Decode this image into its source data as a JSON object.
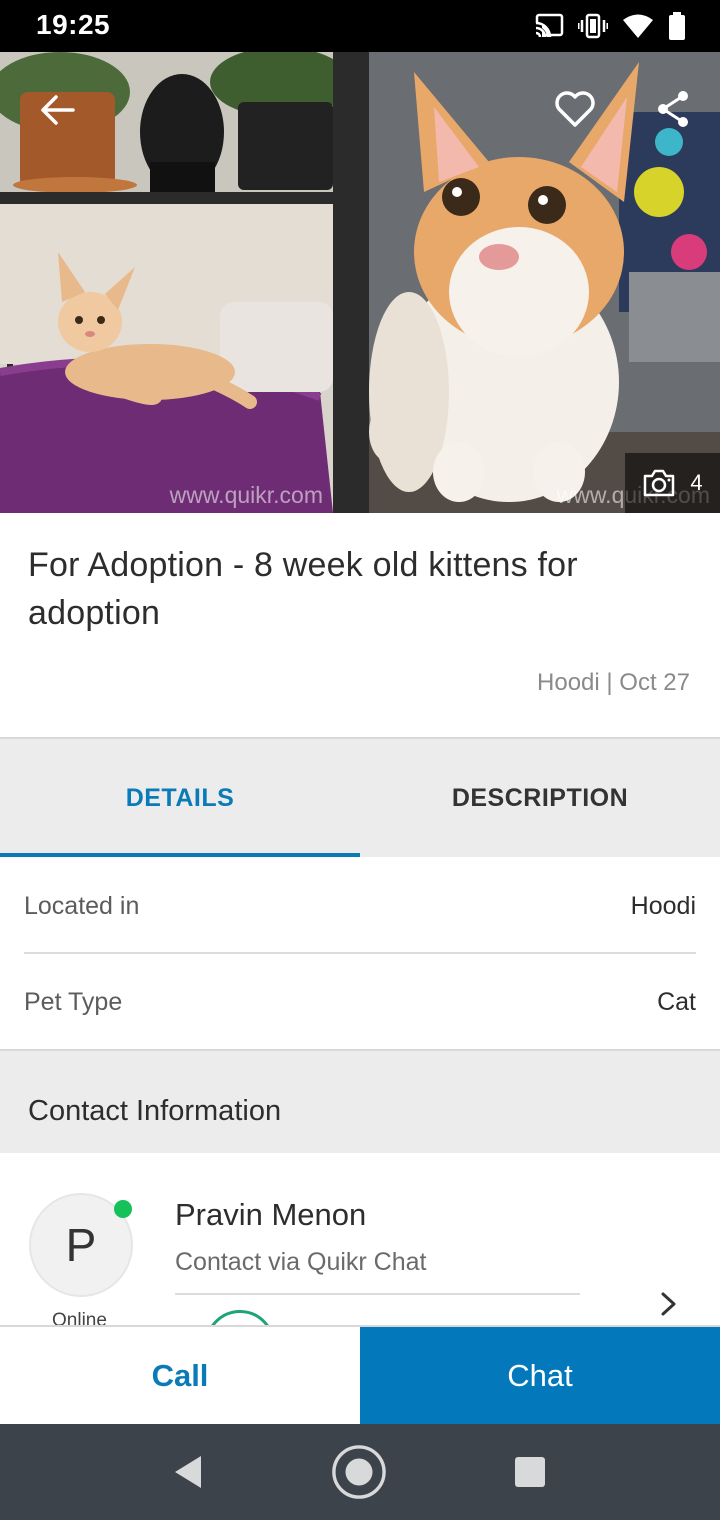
{
  "status_bar": {
    "time": "19:25",
    "icons": [
      "cast-icon",
      "vibrate-icon",
      "wifi-icon",
      "battery-icon"
    ]
  },
  "gallery": {
    "watermark": "www.quikr.com",
    "photo_count": "4",
    "icons": [
      "back-arrow-icon",
      "heart-icon",
      "share-icon",
      "camera-icon"
    ]
  },
  "ad": {
    "title": "For Adoption - 8 week old kittens for adoption",
    "meta": "Hoodi | Oct 27"
  },
  "tabs": [
    {
      "label": "DETAILS",
      "active": true
    },
    {
      "label": "DESCRIPTION",
      "active": false
    }
  ],
  "details": [
    {
      "label": "Located in",
      "value": "Hoodi"
    },
    {
      "label": "Pet Type",
      "value": "Cat"
    }
  ],
  "contact": {
    "header": "Contact Information",
    "avatar_initial": "P",
    "status": "Online",
    "name": "Pravin Menon",
    "via": "Contact via Quikr Chat"
  },
  "actions": {
    "call_label": "Call",
    "chat_label": "Chat"
  },
  "colors": {
    "accent": "#0b7bb8",
    "chat_button": "#0378bb",
    "online": "#16c15a",
    "nav_bar": "#3d434a"
  }
}
